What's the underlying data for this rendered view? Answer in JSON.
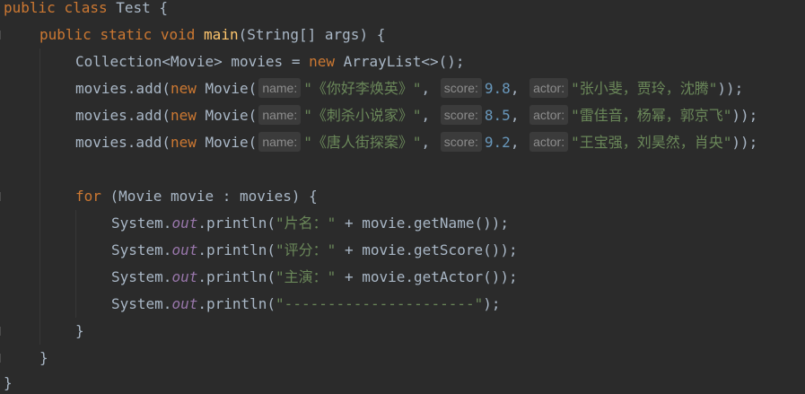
{
  "code": {
    "l1": {
      "kw1": "public",
      "kw2": "class",
      "name": "Test",
      "brace": "{"
    },
    "l2": {
      "kw1": "public",
      "kw2": "static",
      "kw3": "void",
      "fn": "main",
      "params": "(String[] args) {"
    },
    "l3": {
      "type": "Collection<Movie> movies = ",
      "kw": "new",
      "rest": " ArrayList<>();"
    },
    "movies": [
      {
        "prefix": "movies.add(",
        "kw": "new",
        "ctor": " Movie(",
        "hint_name": "name:",
        "title": "\"《你好李焕英》\"",
        "hint_score": "score:",
        "score": "9.8",
        "hint_actor": "actor:",
        "actor": "\"张小斐，贾玲，沈腾\"",
        "close": "));"
      },
      {
        "prefix": "movies.add(",
        "kw": "new",
        "ctor": " Movie(",
        "hint_name": "name:",
        "title": "\"《刺杀小说家》\"",
        "hint_score": "score:",
        "score": "8.5",
        "hint_actor": "actor:",
        "actor": "\"雷佳音，杨幂，郭京飞\"",
        "close": "));"
      },
      {
        "prefix": "movies.add(",
        "kw": "new",
        "ctor": " Movie(",
        "hint_name": "name:",
        "title": "\"《唐人街探案》\"",
        "hint_score": "score:",
        "score": "9.2",
        "hint_actor": "actor:",
        "actor": "\"王宝强，刘昊然，肖央\"",
        "close": "));"
      }
    ],
    "l8": {
      "kw": "for",
      "rest": " (Movie movie : movies) {"
    },
    "prints": [
      {
        "sys": "System.",
        "out": "out",
        "call": ".println(",
        "str": "\"片名：\"",
        "rest": " + movie.getName());"
      },
      {
        "sys": "System.",
        "out": "out",
        "call": ".println(",
        "str": "\"评分：\"",
        "rest": " + movie.getScore());"
      },
      {
        "sys": "System.",
        "out": "out",
        "call": ".println(",
        "str": "\"主演：\"",
        "rest": " + movie.getActor());"
      },
      {
        "sys": "System.",
        "out": "out",
        "call": ".println(",
        "str": "\"----------------------\"",
        "rest": ");"
      }
    ],
    "close_for": "}",
    "close_main": "}",
    "close_class": "}",
    "comma": ", "
  },
  "colors": {
    "background": "#2b2b2b",
    "keyword": "#cc7832",
    "function": "#ffc66d",
    "string": "#6a8759",
    "number": "#6897bb",
    "static_field": "#9876aa",
    "text": "#a9b7c6",
    "inlay_hint_bg": "#3b3b3b"
  }
}
